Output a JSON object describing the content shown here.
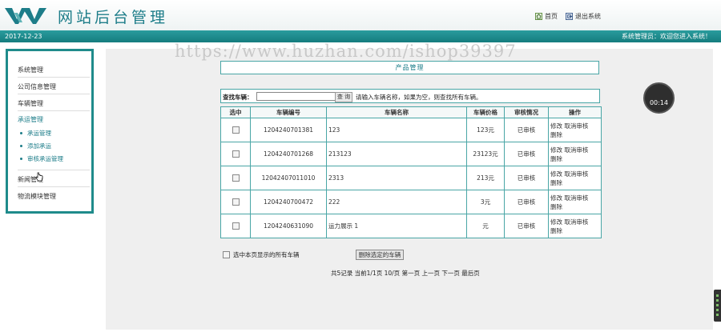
{
  "header": {
    "site_title": "网站后台管理",
    "home_label": "首页",
    "logout_label": "退出系统"
  },
  "infobar": {
    "date": "2017-12-23",
    "welcome": "系统管理员：欢迎您进入系统！"
  },
  "watermark": "https://www.huzhan.com/ishop39397",
  "sidebar": {
    "items": [
      "系统管理",
      "公司信息管理",
      "车辆管理"
    ],
    "active": "承运管理",
    "sub_items": [
      "承运管理",
      "添加承运",
      "审核承运管理"
    ],
    "bottom_items": [
      "新闻管理",
      "物流模块管理"
    ]
  },
  "main": {
    "title": "产品管理",
    "search": {
      "label": "查找车辆：",
      "value": "",
      "button": "查 询",
      "hint": "请输入车辆名称，如果为空，则查找所有车辆。"
    },
    "table": {
      "headers": [
        "选中",
        "车辆编号",
        "车辆名称",
        "车辆价格",
        "审核情况",
        "操作"
      ],
      "rows": [
        {
          "id": "1204240701381",
          "name": "123",
          "price": "123元",
          "status": "已审核"
        },
        {
          "id": "1204240701268",
          "name": "213123",
          "price": "23123元",
          "status": "已审核"
        },
        {
          "id": "12042407011010",
          "name": "2313",
          "price": "213元",
          "status": "已审核"
        },
        {
          "id": "1204240700472",
          "name": "222",
          "price": "3元",
          "status": "已审核"
        },
        {
          "id": "1204240631090",
          "name": "运力展示 1",
          "price": "元",
          "status": "已审核"
        }
      ],
      "op_edit": "修改",
      "op_cancel": "取消审核",
      "op_delete": "删除"
    },
    "select_all_label": "选中本页显示的所有车辆",
    "delete_selected": "删除选定的车辆",
    "pager": "共5记录 当前1/1页 10/页 第一页 上一页 下一页 最后页"
  },
  "timer": "00:14",
  "colors": {
    "accent": "#1f8b8b",
    "title": "#1d7d89",
    "bar": "#157c7e"
  }
}
